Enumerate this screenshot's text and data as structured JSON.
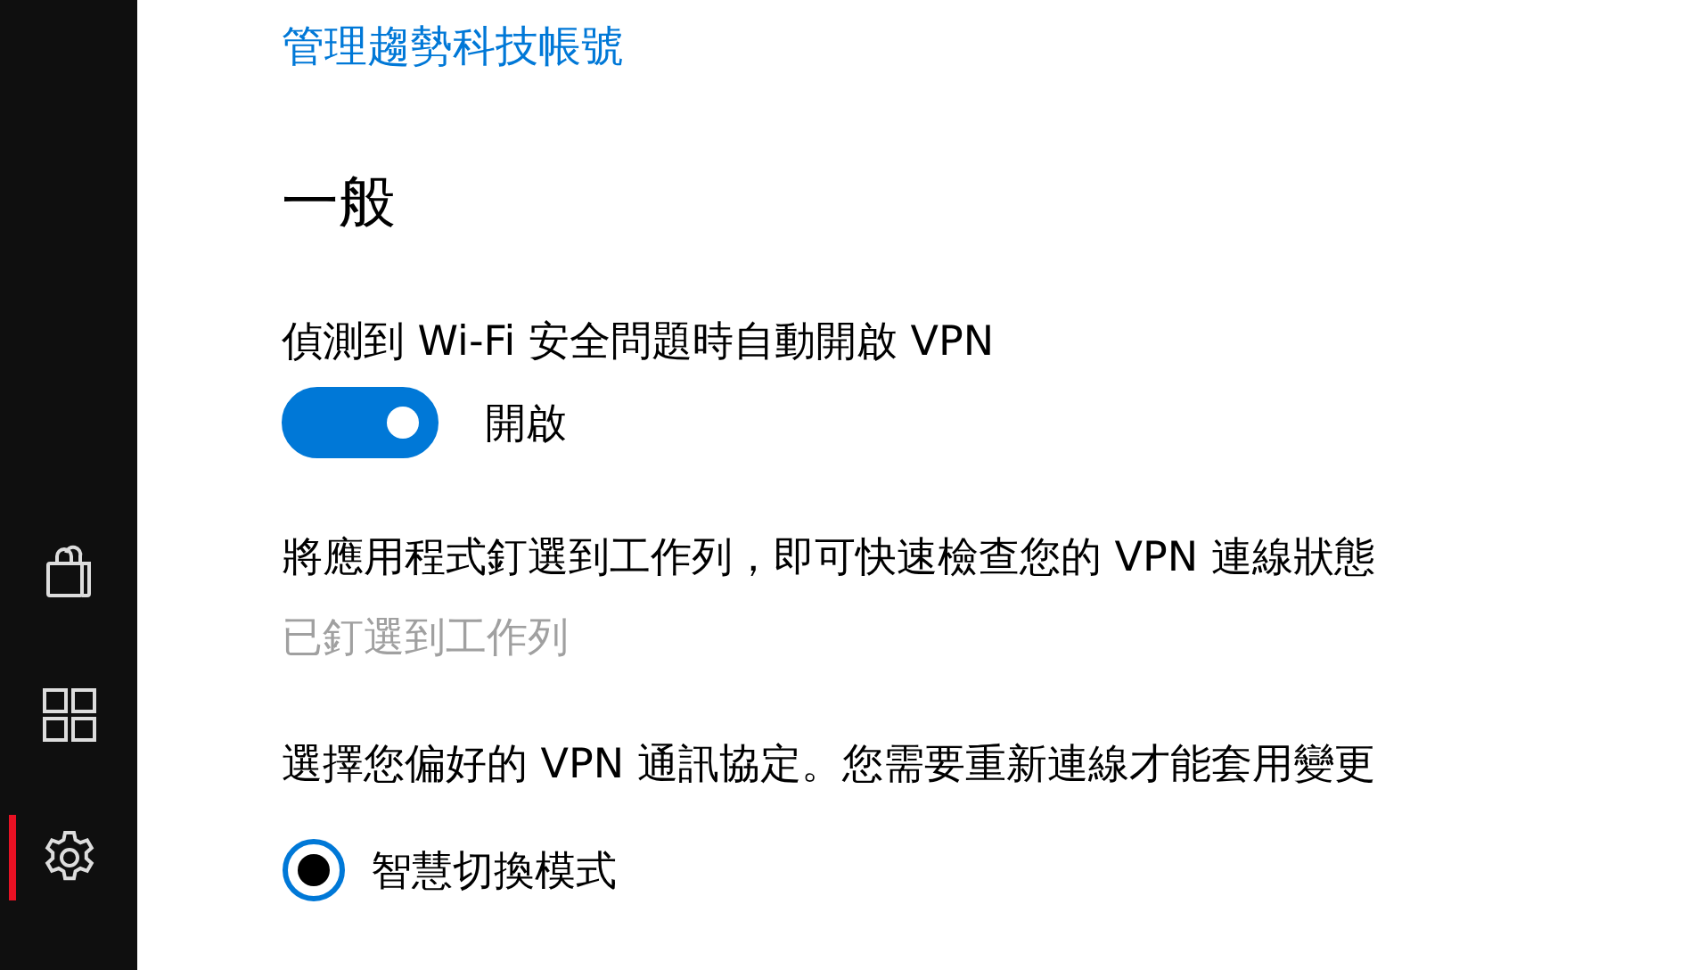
{
  "sidebar": {
    "items": [
      {
        "kind": "store",
        "selected": false
      },
      {
        "kind": "apps",
        "selected": false
      },
      {
        "kind": "settings",
        "selected": true
      }
    ]
  },
  "account_link": "管理趨勢科技帳號",
  "section_title": "一般",
  "auto_vpn": {
    "label": "偵測到 Wi-Fi 安全問題時自動開啟 VPN",
    "on": true,
    "state_text": "開啟"
  },
  "pin": {
    "description": "將應用程式釘選到工作列，即可快速檢查您的 VPN 連線狀態",
    "button": "已釘選到工作列",
    "disabled": true
  },
  "protocol": {
    "description": "選擇您偏好的 VPN 通訊協定。您需要重新連線才能套用變更",
    "options": [
      {
        "label": "智慧切換模式",
        "selected": true
      }
    ]
  }
}
